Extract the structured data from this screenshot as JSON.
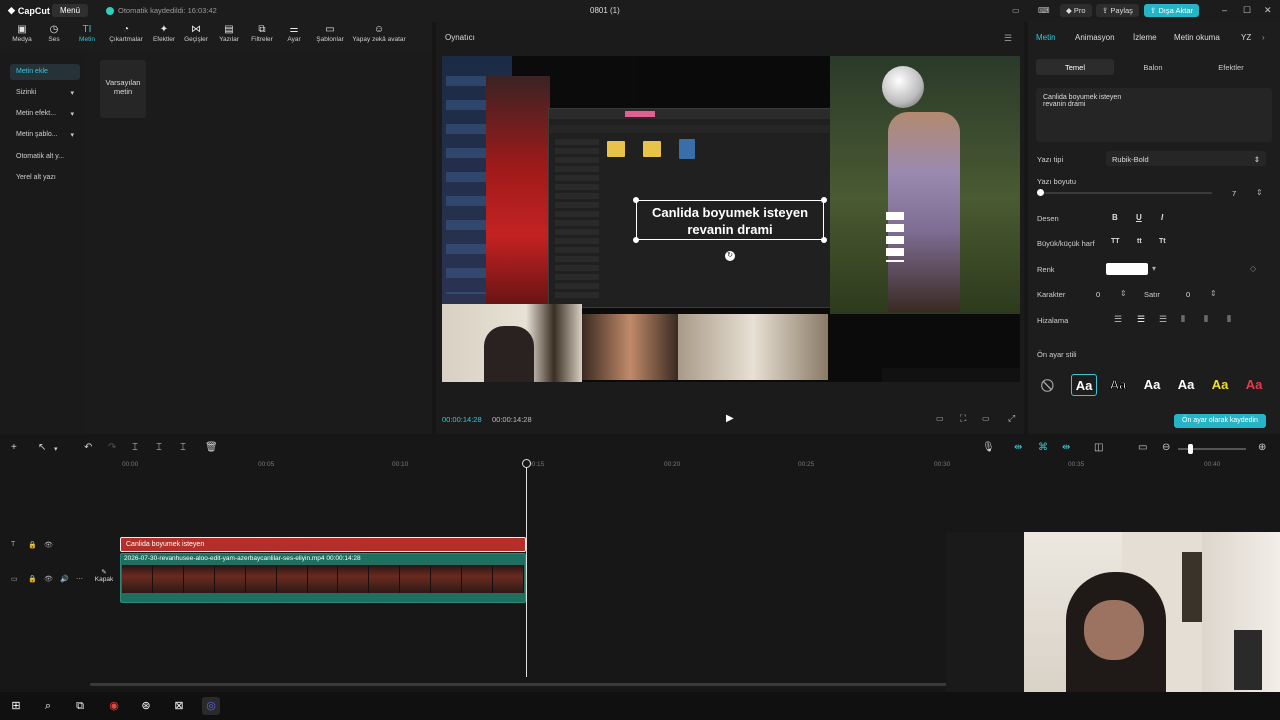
{
  "titlebar": {
    "brand": "CapCut",
    "menu": "Menü",
    "saved_status": "Otomatik kaydedildi: 16:03:42",
    "project_title": "0801 (1)",
    "pro": "Pro",
    "share": "Paylaş",
    "export": "Dışa Aktar"
  },
  "toolbar": {
    "items": [
      {
        "label": "Medya",
        "icon": "media-icon"
      },
      {
        "label": "Ses",
        "icon": "audio-icon"
      },
      {
        "label": "Metin",
        "icon": "text-icon"
      },
      {
        "label": "Çıkartmalar",
        "icon": "sticker-icon"
      },
      {
        "label": "Efektler",
        "icon": "effects-icon"
      },
      {
        "label": "Geçişler",
        "icon": "transition-icon"
      },
      {
        "label": "Yazılar",
        "icon": "captions-icon"
      },
      {
        "label": "Filtreler",
        "icon": "filter-icon"
      },
      {
        "label": "Ayar",
        "icon": "adjust-icon"
      },
      {
        "label": "Şablonlar",
        "icon": "template-icon"
      },
      {
        "label": "Yapay zekâ avatar",
        "icon": "avatar-icon"
      }
    ]
  },
  "library": {
    "side": [
      "Metin ekle",
      "Sizinki",
      "Metin efekt...",
      "Metin şablo...",
      "Otomatik alt y...",
      "Yerel alt yazı"
    ],
    "card": "Varsayılan metin"
  },
  "player": {
    "title": "Oynatıcı",
    "caption_line1": "Canlida boyumek isteyen",
    "caption_line2": "revanin drami",
    "time_current": "00:00:14:28",
    "time_total": "00:00:14:28"
  },
  "right_panel": {
    "tabs": [
      "Metin",
      "Animasyon",
      "İzleme",
      "Metin okuma",
      "YZ"
    ],
    "subtabs": [
      "Temel",
      "Balon",
      "Efektler"
    ],
    "text_content": "Canlida boyumek isteyen revanin drami",
    "font_label": "Yazı tipi",
    "font_value": "Rubik-Bold",
    "size_label": "Yazı boyutu",
    "size_value": "7",
    "pattern_label": "Desen",
    "case_label": "Büyük/küçük harf",
    "color_label": "Renk",
    "char_label": "Karakter",
    "char_value": "0",
    "line_label": "Satır",
    "line_value": "0",
    "align_label": "Hizalama",
    "preset_label": "Ön ayar stili",
    "save_preset": "Ön ayar olarak kaydedin",
    "preset_text": "Aa",
    "colors": {
      "accent": "#34c8d8",
      "text_clip": "#b52e2a",
      "video_clip": "#1f6f61"
    }
  },
  "timeline": {
    "ruler": [
      "00:00",
      "00:05",
      "00:10",
      "00:15",
      "00:20",
      "00:25",
      "00:30",
      "00:35",
      "00:40"
    ],
    "text_clip": "Canlida boyumek isteyen",
    "video_clip": "2026-07-30-revanhusee-aloo-edit-yam-azerbaycanlilar-ses-eliyin.mp4",
    "video_duration": "00:00:14:28",
    "cover": "Kapak"
  }
}
